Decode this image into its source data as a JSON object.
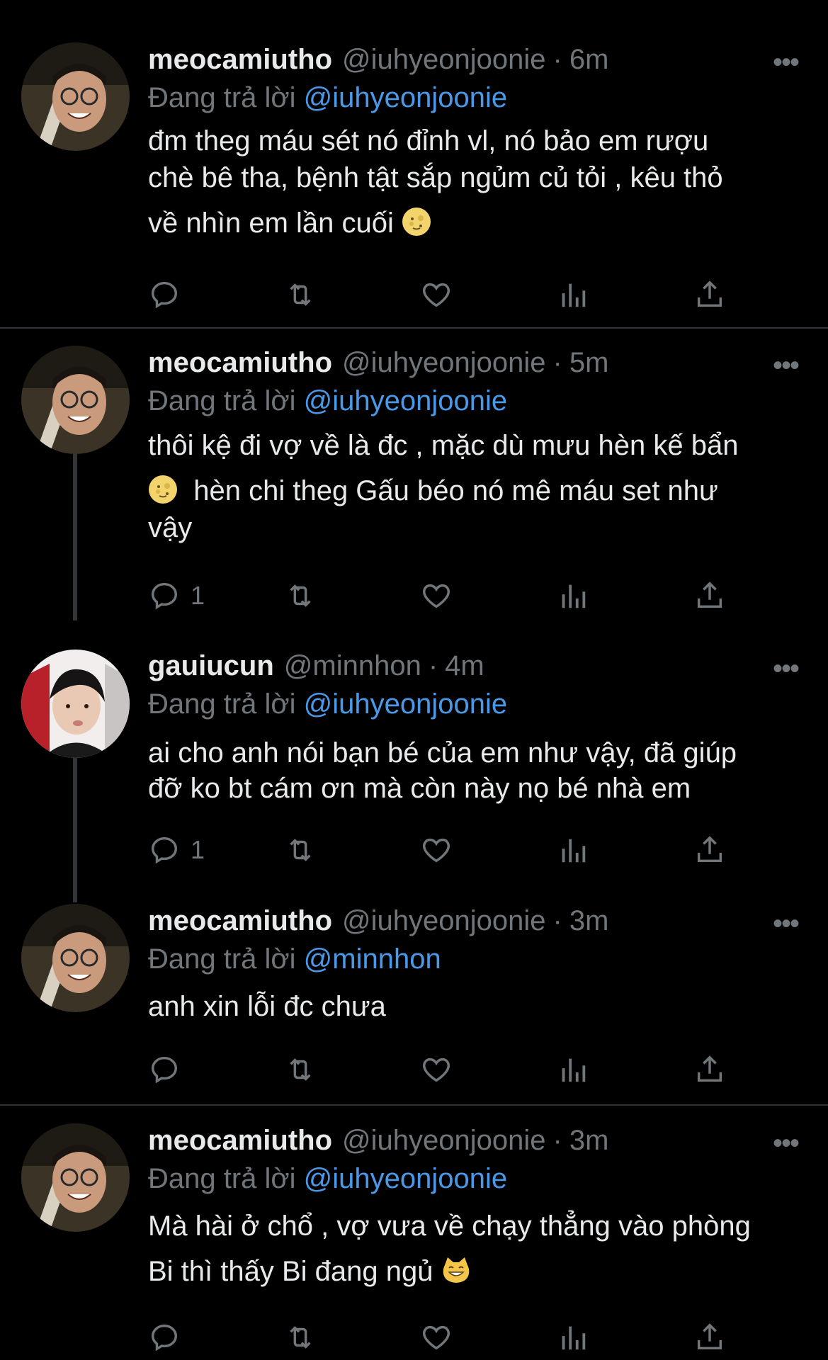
{
  "reply_prefix": "Đang trả lời",
  "tweets": [
    {
      "name": "meocamiutho",
      "handle": "@iuhyeonjoonie",
      "dot": "·",
      "time": "6m",
      "reply_to": "@iuhyeonjoonie",
      "lines": [
        "đm theg máu sét nó đỉnh vl, nó bảo em rượu",
        "chè bê tha, bệnh tật sắp ngủm củ tỏi , kêu thỏ",
        "về nhìn em lần cuối"
      ],
      "emoji": "moon-face-emoji",
      "reply_count": ""
    },
    {
      "name": "meocamiutho",
      "handle": "@iuhyeonjoonie",
      "dot": "·",
      "time": "5m",
      "reply_to": "@iuhyeonjoonie",
      "lines": [
        "thôi kệ đi vợ về là đc , mặc dù mưu hèn kế bẩn",
        "hèn chi theg Gấu béo nó mê máu set như",
        "vậy"
      ],
      "emoji": "moon-face-emoji",
      "reply_count": "1"
    },
    {
      "name": "gauiucun",
      "handle": "@minnhon",
      "dot": "·",
      "time": "4m",
      "reply_to": "@iuhyeonjoonie",
      "lines": [
        "ai cho anh nói bạn bé của em như vậy, đã giúp",
        "đỡ ko bt cám ơn mà còn này nọ bé nhà em"
      ],
      "reply_count": "1"
    },
    {
      "name": "meocamiutho",
      "handle": "@iuhyeonjoonie",
      "dot": "·",
      "time": "3m",
      "reply_to": "@minnhon",
      "lines": [
        "anh xin lỗi đc chưa"
      ],
      "reply_count": ""
    },
    {
      "name": "meocamiutho",
      "handle": "@iuhyeonjoonie",
      "dot": "·",
      "time": "3m",
      "reply_to": "@iuhyeonjoonie",
      "lines": [
        "Mà hài ở chổ , vợ vưa về chạy thẳng vào phòng",
        "Bi thì thấy Bi đang ngủ"
      ],
      "emoji": "cat-grin-emoji",
      "reply_count": ""
    }
  ],
  "more_glyph": "•••",
  "colors": {
    "background": "#000000",
    "text": "#e7e9ea",
    "muted": "#71767b",
    "mention": "#4a99e9",
    "divider": "#2f3336"
  }
}
